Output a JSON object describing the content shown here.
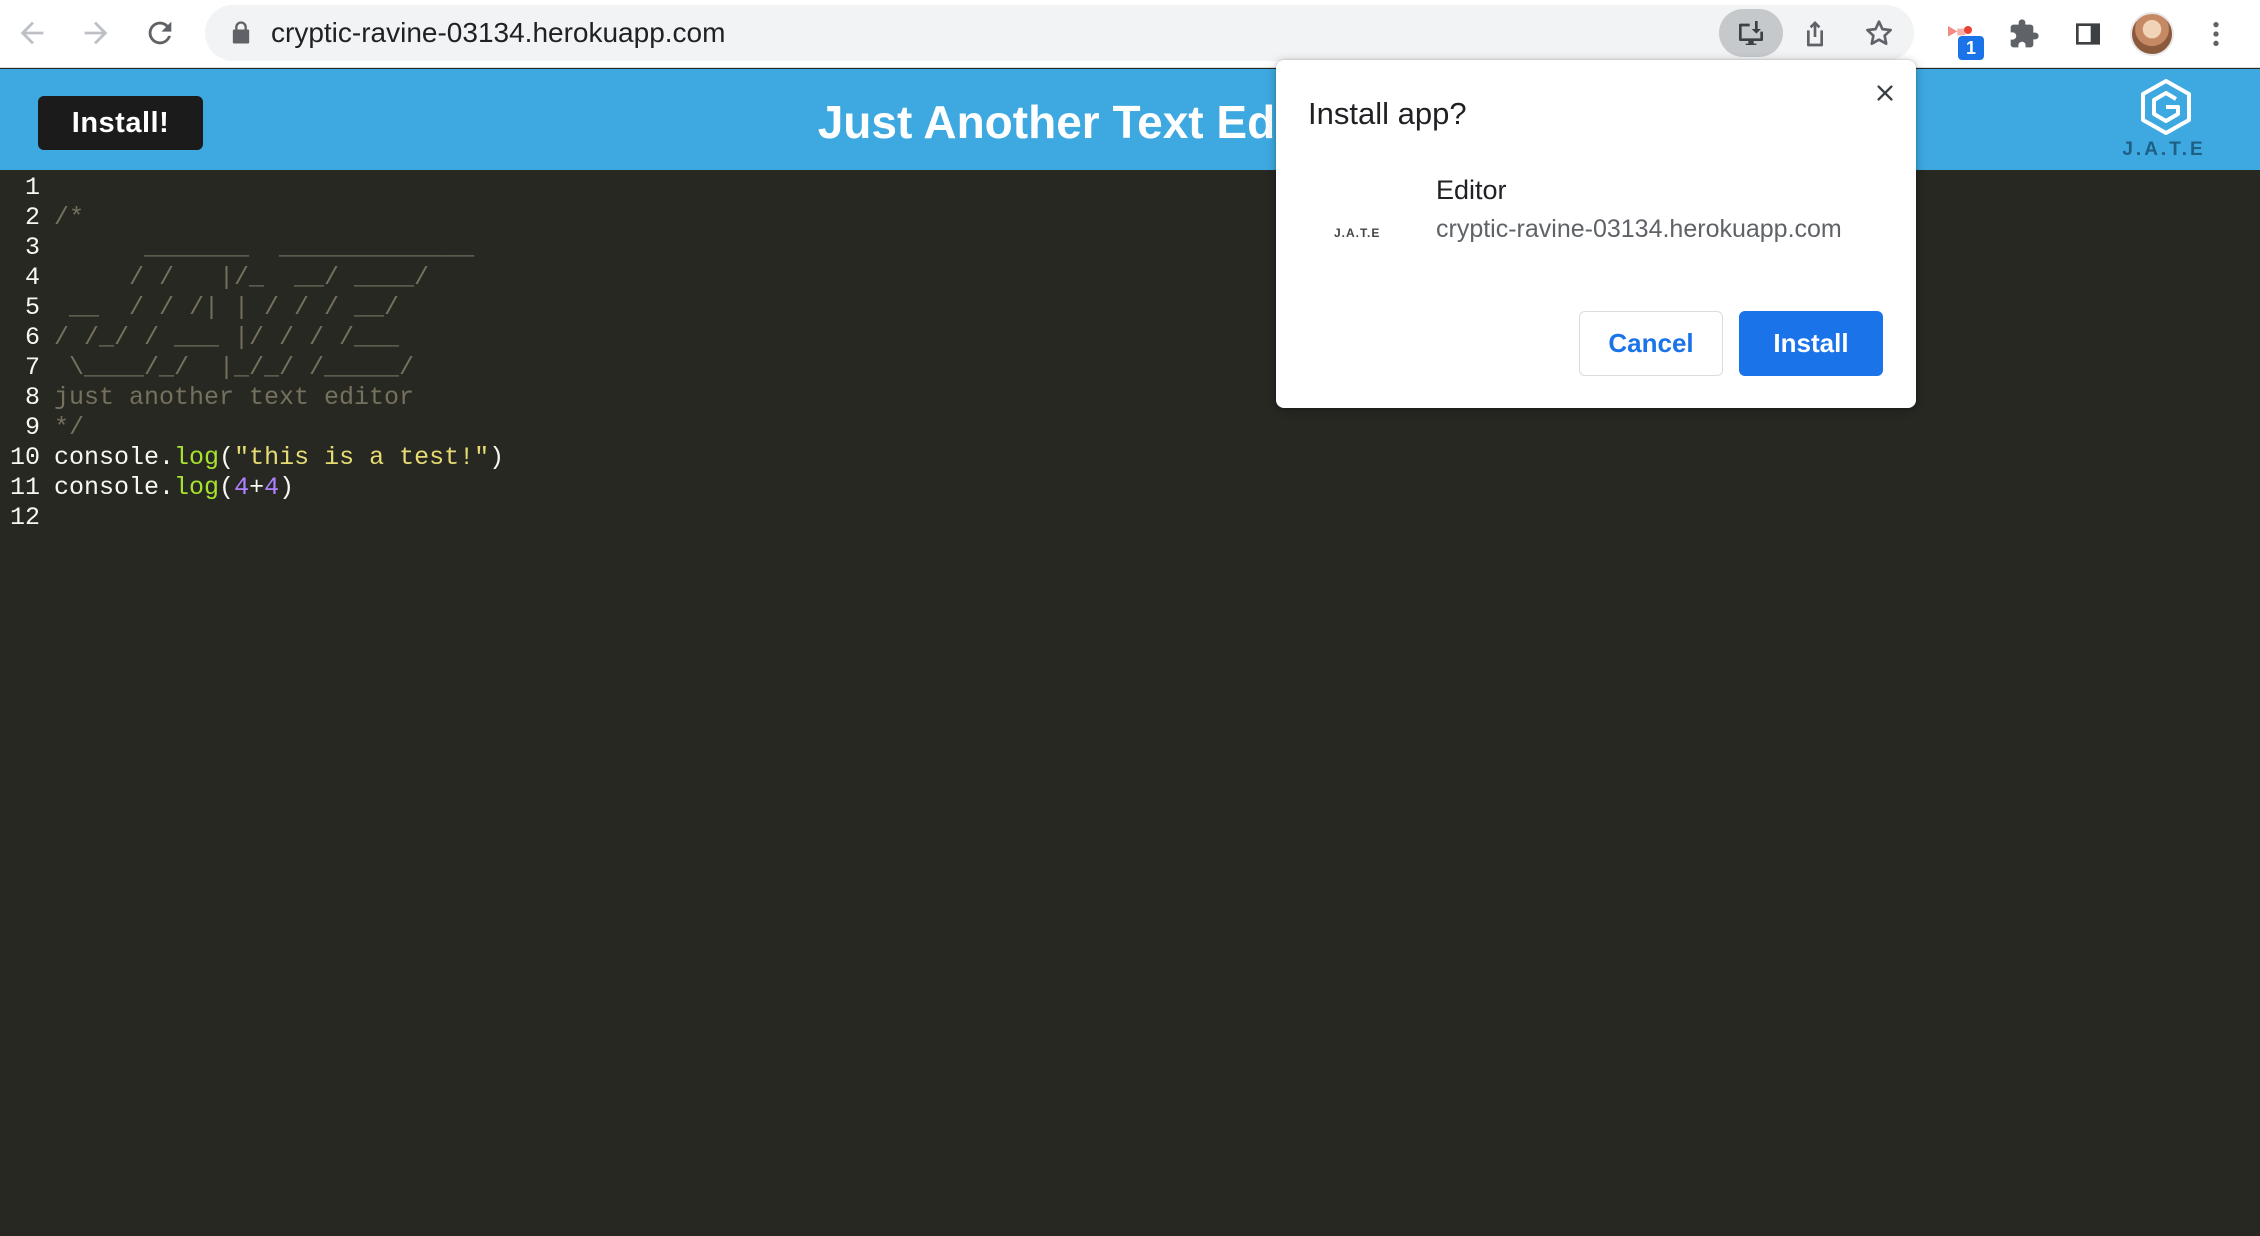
{
  "browser": {
    "url": "cryptic-ravine-03134.herokuapp.com",
    "extension_badge": "1"
  },
  "app": {
    "install_label": "Install!",
    "title": "Just Another Text Editor",
    "logo_text": "J.A.T.E"
  },
  "editor": {
    "line_numbers": [
      "1",
      "2",
      "3",
      "4",
      "5",
      "6",
      "7",
      "8",
      "9",
      "10",
      "11",
      "12"
    ],
    "lines": [
      [],
      [
        {
          "t": "/*",
          "c": "comment"
        }
      ],
      [
        {
          "t": "      _______  _____________",
          "c": "comment"
        }
      ],
      [
        {
          "t": "     / /   |/_  __/ ____/",
          "c": "comment"
        }
      ],
      [
        {
          "t": " __  / / /| | / / / __/",
          "c": "comment"
        }
      ],
      [
        {
          "t": "/ /_/ / ___ |/ / / /___",
          "c": "comment"
        }
      ],
      [
        {
          "t": " \\____/_/  |_/_/ /_____/",
          "c": "comment"
        }
      ],
      [
        {
          "t": "just another text editor",
          "c": "comment"
        }
      ],
      [
        {
          "t": "*/",
          "c": "comment"
        }
      ],
      [
        {
          "t": "console.",
          "c": "plain"
        },
        {
          "t": "log",
          "c": "func"
        },
        {
          "t": "(",
          "c": "plain"
        },
        {
          "t": "\"this is a test!\"",
          "c": "string"
        },
        {
          "t": ")",
          "c": "plain"
        }
      ],
      [
        {
          "t": "console.",
          "c": "plain"
        },
        {
          "t": "log",
          "c": "func"
        },
        {
          "t": "(",
          "c": "plain"
        },
        {
          "t": "4",
          "c": "num"
        },
        {
          "t": "+",
          "c": "plain"
        },
        {
          "t": "4",
          "c": "num"
        },
        {
          "t": ")",
          "c": "plain"
        }
      ],
      []
    ]
  },
  "dialog": {
    "title": "Install app?",
    "app_icon_text": "J.A.T.E",
    "app_name": "Editor",
    "origin": "cryptic-ravine-03134.herokuapp.com",
    "cancel_label": "Cancel",
    "install_label": "Install"
  },
  "colors": {
    "header": "#3da9e0",
    "editor_bg": "#272822",
    "accent": "#1a73e8"
  },
  "icons": [
    "back-arrow-icon",
    "forward-arrow-icon",
    "reload-icon",
    "lock-icon",
    "install-app-icon",
    "share-icon",
    "bookmark-star-icon",
    "extension-icon",
    "puzzle-icon",
    "side-panel-icon",
    "avatar",
    "more-vert-icon",
    "jate-logo-icon",
    "close-icon"
  ]
}
